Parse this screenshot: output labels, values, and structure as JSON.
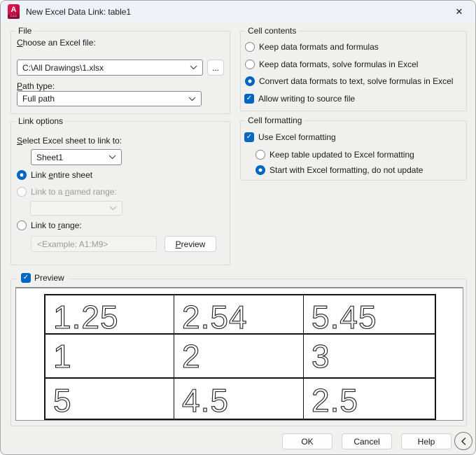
{
  "window": {
    "title": "New Excel Data Link: table1",
    "app_icon": {
      "letter": "A",
      "sub": "CAD"
    }
  },
  "icons": {
    "close": "✕",
    "check": "✓"
  },
  "colors": {
    "accent": "#0067c0"
  },
  "file_group": {
    "title": "File",
    "choose_label": {
      "pre": "",
      "key": "C",
      "post": "hoose an Excel file:"
    },
    "file_combo": {
      "value": "C:\\All Drawings\\1.xlsx"
    },
    "browse_label": "...",
    "path_type_label": {
      "pre": "",
      "key": "P",
      "post": "ath type:"
    },
    "path_combo": {
      "value": "Full path"
    }
  },
  "link_options": {
    "title": "Link options",
    "select_sheet_label": {
      "pre": "",
      "key": "S",
      "post": "elect Excel sheet to link to:"
    },
    "sheet_combo": {
      "value": "Sheet1"
    },
    "radio_entire": {
      "pre": "Link ",
      "key": "e",
      "post": "ntire sheet",
      "checked": true
    },
    "radio_named": {
      "pre": "Link to a ",
      "key": "n",
      "post": "amed range:",
      "checked": false,
      "disabled": true
    },
    "named_combo": {
      "value": ""
    },
    "radio_range": {
      "pre": "Link to ",
      "key": "r",
      "post": "ange:",
      "checked": false
    },
    "range_placeholder": "<Example: A1:M9>",
    "preview_button": {
      "pre": "",
      "key": "P",
      "post": "review"
    }
  },
  "cell_contents": {
    "title": "Cell contents",
    "options": [
      {
        "label": "Keep data formats and formulas",
        "checked": false
      },
      {
        "label": "Keep data formats, solve formulas in Excel",
        "checked": false
      },
      {
        "label": "Convert data formats to text, solve formulas in Excel",
        "checked": true
      }
    ],
    "allow_write": {
      "label": "Allow writing to source file",
      "checked": true
    }
  },
  "cell_formatting": {
    "title": "Cell formatting",
    "use_excel": {
      "label": "Use Excel formatting",
      "checked": true
    },
    "options": [
      {
        "label": "Keep table updated to Excel formatting",
        "checked": false
      },
      {
        "label": "Start with Excel formatting, do not update",
        "checked": true
      }
    ]
  },
  "preview": {
    "label": "Preview",
    "checked": true,
    "table": {
      "rows": [
        [
          "1.25",
          "2.54",
          "5.45"
        ],
        [
          "1",
          "2",
          "3"
        ],
        [
          "5",
          "4.5",
          "2.5"
        ]
      ]
    }
  },
  "footer": {
    "ok": "OK",
    "cancel": "Cancel",
    "help": "Help"
  }
}
